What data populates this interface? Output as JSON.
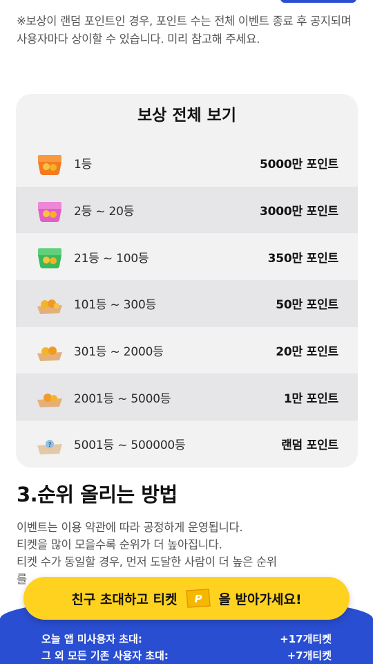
{
  "notice": "※보상이 랜덤 포인트인 경우, 포인트 수는 전체 이벤트 종료 후 공지되며 사용자마다 상이할 수 있습니다. 미리 참고해 주세요.",
  "reward_table": {
    "title": "보상 전체 보기",
    "rows": [
      {
        "rank": "1등",
        "prize": "5000만 포인트",
        "icon": "orange-lunchbox-icon",
        "color": "#f47a22"
      },
      {
        "rank": "2등 ~ 20등",
        "prize": "3000만 포인트",
        "icon": "pink-lunchbox-icon",
        "color": "#e45dc6"
      },
      {
        "rank": "21등 ~ 100등",
        "prize": "350만 포인트",
        "icon": "green-lunchbox-icon",
        "color": "#38b95a"
      },
      {
        "rank": "101등 ~ 300등",
        "prize": "50만 포인트",
        "icon": "snack-tray-icon",
        "color": "#f4b429"
      },
      {
        "rank": "301등 ~ 2000등",
        "prize": "20만 포인트",
        "icon": "snack-tray-icon",
        "color": "#f4b429"
      },
      {
        "rank": "2001등 ~ 5000등",
        "prize": "1만 포인트",
        "icon": "snack-tray-icon",
        "color": "#f49a29"
      },
      {
        "rank": "5001등 ~ 500000등",
        "prize": "랜덤 포인트",
        "icon": "mystery-tray-icon",
        "color": "#8fc2e8"
      }
    ]
  },
  "section": {
    "title": "3.순위 올리는 방법",
    "lines": [
      "이벤트는 이용 약관에 따라 공정하게 운영됩니다.",
      "티켓을 많이 모을수록 순위가 더 높아집니다.",
      "티켓 수가 동일할 경우, 먼저 도달한 사람이 더 높은 순위",
      "를"
    ]
  },
  "cta": {
    "label_before": "친구 초대하고 티켓",
    "label_after": "을 받아가세요!",
    "ticket_icon": "ticket-icon"
  },
  "invite_rewards": [
    {
      "label": "오늘 앱 미사용자 초대:",
      "value": "+17개티켓"
    },
    {
      "label": "그 외 모든 기존 사용자 초대:",
      "value": "+7개티켓"
    }
  ],
  "colors": {
    "brand_blue": "#2a4ed1",
    "cta_yellow": "#ffd21f",
    "ticket": "#f5b800"
  }
}
